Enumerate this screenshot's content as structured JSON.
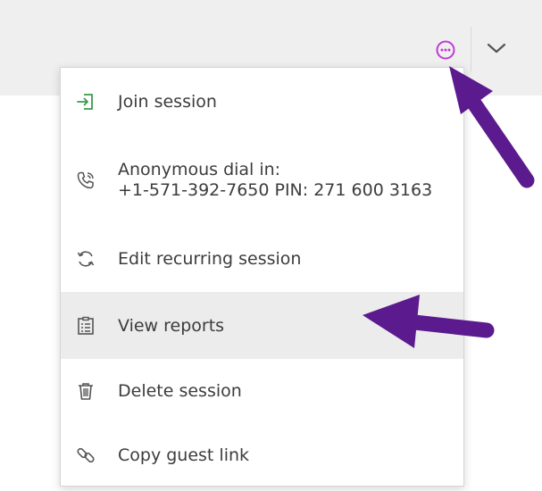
{
  "header": {
    "more_icon": "more-options-icon",
    "chevron_icon": "chevron-down-icon",
    "accent_color": "#c03ad8"
  },
  "menu": {
    "items": [
      {
        "label": "Join session",
        "icon": "join-session-icon",
        "icon_color": "#3a9b4a"
      },
      {
        "label_line1": "Anonymous dial in:",
        "label_line2": "+1-571-392-7650 PIN: 271 600 3163",
        "icon": "phone-icon"
      },
      {
        "label": "Edit recurring session",
        "icon": "recurring-icon"
      },
      {
        "label": "View reports",
        "icon": "report-icon",
        "highlighted": true
      },
      {
        "label": "Delete session",
        "icon": "trash-icon"
      },
      {
        "label": "Copy guest link",
        "icon": "link-icon"
      }
    ]
  },
  "annotations": {
    "arrow_color": "#5b1a8e"
  }
}
